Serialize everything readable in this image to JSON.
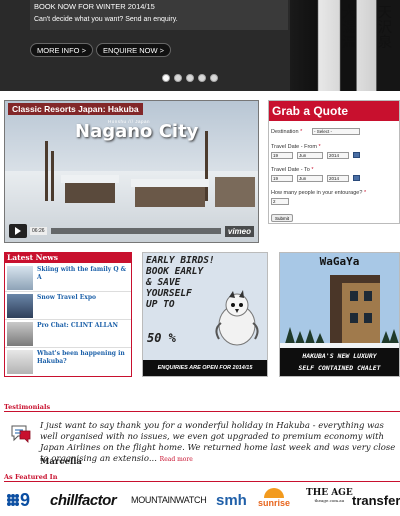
{
  "hero": {
    "headline": "BOOK NOW FOR WINTER 2014/15",
    "subtext": "Can't decide what you want? Send an enquiry.",
    "more_info_label": "MORE INFO >",
    "enquire_label": "ENQUIRE NOW >",
    "slide_count": 5,
    "active_slide": 1
  },
  "video": {
    "overlay_title": "Classic Resorts Japan: Hakuba",
    "small_title": "Honshu /// Japan",
    "big_title": "Nagano City",
    "time": "06:26",
    "brand": "vimeo"
  },
  "quote": {
    "title": "Grab a Quote",
    "destination_label": "Destination",
    "destination_value": "- Select -",
    "from_label": "Travel Date - From",
    "from_day": "19",
    "from_month": "Jun",
    "from_year": "2014",
    "to_label": "Travel Date - To",
    "to_day": "19",
    "to_month": "Jun",
    "to_year": "2014",
    "people_label": "How many people in your entourage?",
    "people_value": "2",
    "submit_label": "Submit",
    "required_mark": "*"
  },
  "news": {
    "title": "Latest News",
    "items": [
      {
        "text": "Skiing with the family Q & A"
      },
      {
        "text": "Snow Travel Expo"
      },
      {
        "text": "Pro Chat: CLINT ALLAN"
      },
      {
        "text": "What's been happening in Hakuba?"
      }
    ]
  },
  "early": {
    "line1": "EARLY BIRDS!",
    "line2": "BOOK EARLY",
    "line3": "& SAVE",
    "line4": "YOURSELF",
    "line5": "UP TO",
    "pct": "50 %",
    "footer": "ENQUIRIES ARE OPEN FOR 2014/15"
  },
  "wagaya": {
    "title": "WaGaYa",
    "footer1": "HAKUBA'S NEW LUXURY",
    "footer2": "SELF CONTAINED CHALET"
  },
  "testimonials": {
    "heading": "Testimonials",
    "text": "I just want to say thank you for a wonderful holiday in Hakuba - everything was well organised with no issues, we even got upgraded to premium economy with Japan Airlines on the flight home. We returned home last week and was very close to organising an extensio...",
    "read_more": "Read more",
    "author": "Marcella"
  },
  "featured": {
    "heading": "As Featured In",
    "logos": [
      "9",
      "chillfactor",
      "MOUNTAINWATCH",
      "smh",
      "sunrise",
      "THE AGE",
      "transfer"
    ],
    "age_sub": "theage.com.au"
  },
  "colors": {
    "accent": "#c8102e",
    "link": "#1a5fa8"
  }
}
